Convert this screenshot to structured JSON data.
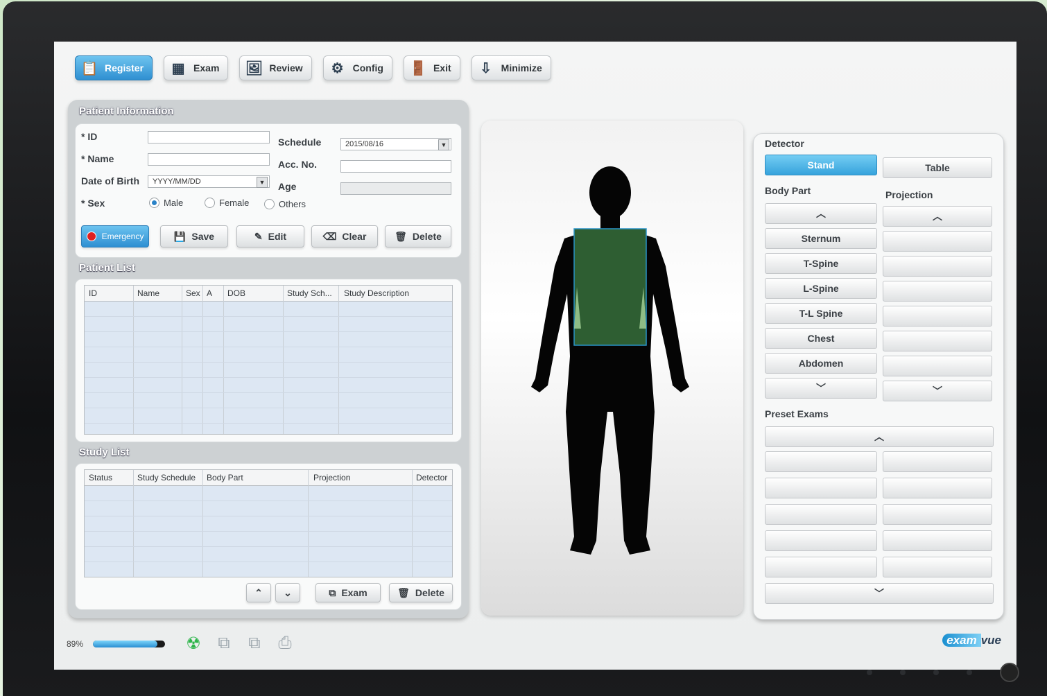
{
  "toolbar": {
    "items": [
      {
        "label": "Register",
        "icon": "register-icon"
      },
      {
        "label": "Exam",
        "icon": "exam-icon"
      },
      {
        "label": "Review",
        "icon": "review-icon"
      },
      {
        "label": "Config",
        "icon": "config-icon"
      },
      {
        "label": "Exit",
        "icon": "exit-icon"
      },
      {
        "label": "Minimize",
        "icon": "minimize-icon"
      }
    ]
  },
  "patient_info": {
    "title": "Patient Information",
    "id_label": "* ID",
    "name_label": "* Name",
    "dob_label": "Date of Birth",
    "dob_value": "YYYY/MM/DD",
    "sex_label": "* Sex",
    "sex_options": [
      "Male",
      "Female",
      "Others"
    ],
    "sex_selected": "Male",
    "schedule_label": "Schedule",
    "schedule_value": "2015/08/16",
    "acc_label": "Acc. No.",
    "age_label": "Age",
    "buttons": {
      "emergency": "Emergency",
      "save": "Save",
      "edit": "Edit",
      "clear": "Clear",
      "delete": "Delete"
    }
  },
  "patient_list": {
    "title": "Patient List",
    "columns": [
      "ID",
      "Name",
      "Sex",
      "A",
      "DOB",
      "Study Sch...",
      "Study Description"
    ]
  },
  "study_list": {
    "title": "Study List",
    "columns": [
      "Status",
      "Study Schedule",
      "Body Part",
      "Projection",
      "Detector"
    ],
    "buttons": {
      "exam": "Exam",
      "delete": "Delete"
    }
  },
  "detector": {
    "title": "Detector",
    "options": [
      "Stand",
      "Table"
    ],
    "selected": "Stand"
  },
  "body_part": {
    "title": "Body Part",
    "items": [
      "Sternum",
      "T-Spine",
      "L-Spine",
      "T-L Spine",
      "Chest",
      "Abdomen"
    ]
  },
  "projection": {
    "title": "Projection"
  },
  "preset_exams": {
    "title": "Preset Exams"
  },
  "status": {
    "progress_label": "89%",
    "progress": 0.89
  },
  "brand": {
    "logo_prefix": "exam",
    "logo_suffix": "vue"
  },
  "colors": {
    "accent": "#2f8fd1",
    "highlight": "#2e5e32",
    "emergency": "#e02020"
  }
}
